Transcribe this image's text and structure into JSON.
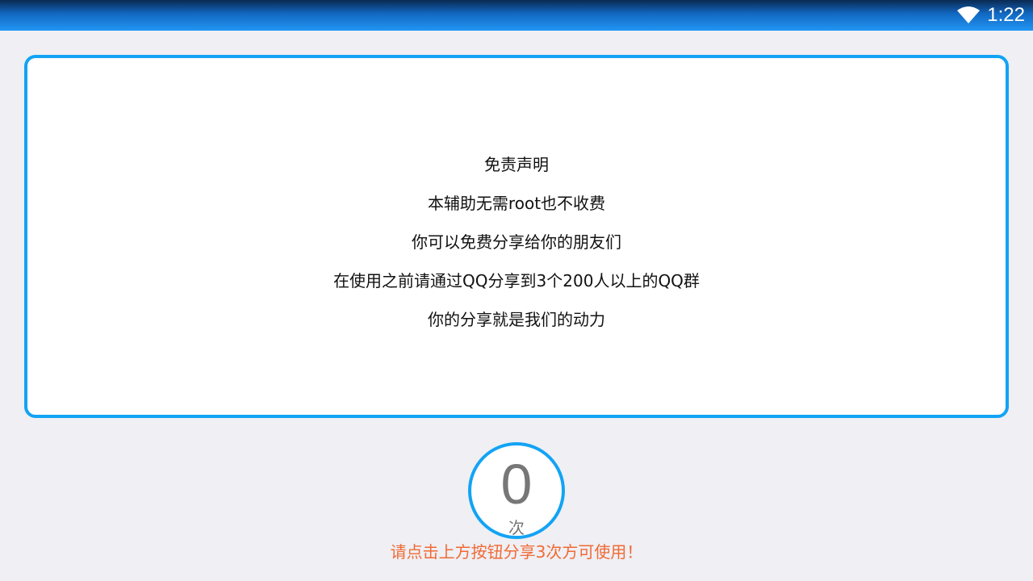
{
  "status_bar": {
    "time": "1:22",
    "wifi_icon": "wifi-icon"
  },
  "disclaimer": {
    "lines": [
      "免责声明",
      "本辅助无需root也不收费",
      "你可以免费分享给你的朋友们",
      "在使用之前请通过QQ分享到3个200人以上的QQ群",
      "你的分享就是我们的动力"
    ]
  },
  "share_counter": {
    "count": "0",
    "unit": "次"
  },
  "hint": "请点击上方按钮分享3次方可使用！",
  "colors": {
    "accent": "#13a3f4",
    "hint": "#f06a34",
    "background": "#efeff4"
  }
}
